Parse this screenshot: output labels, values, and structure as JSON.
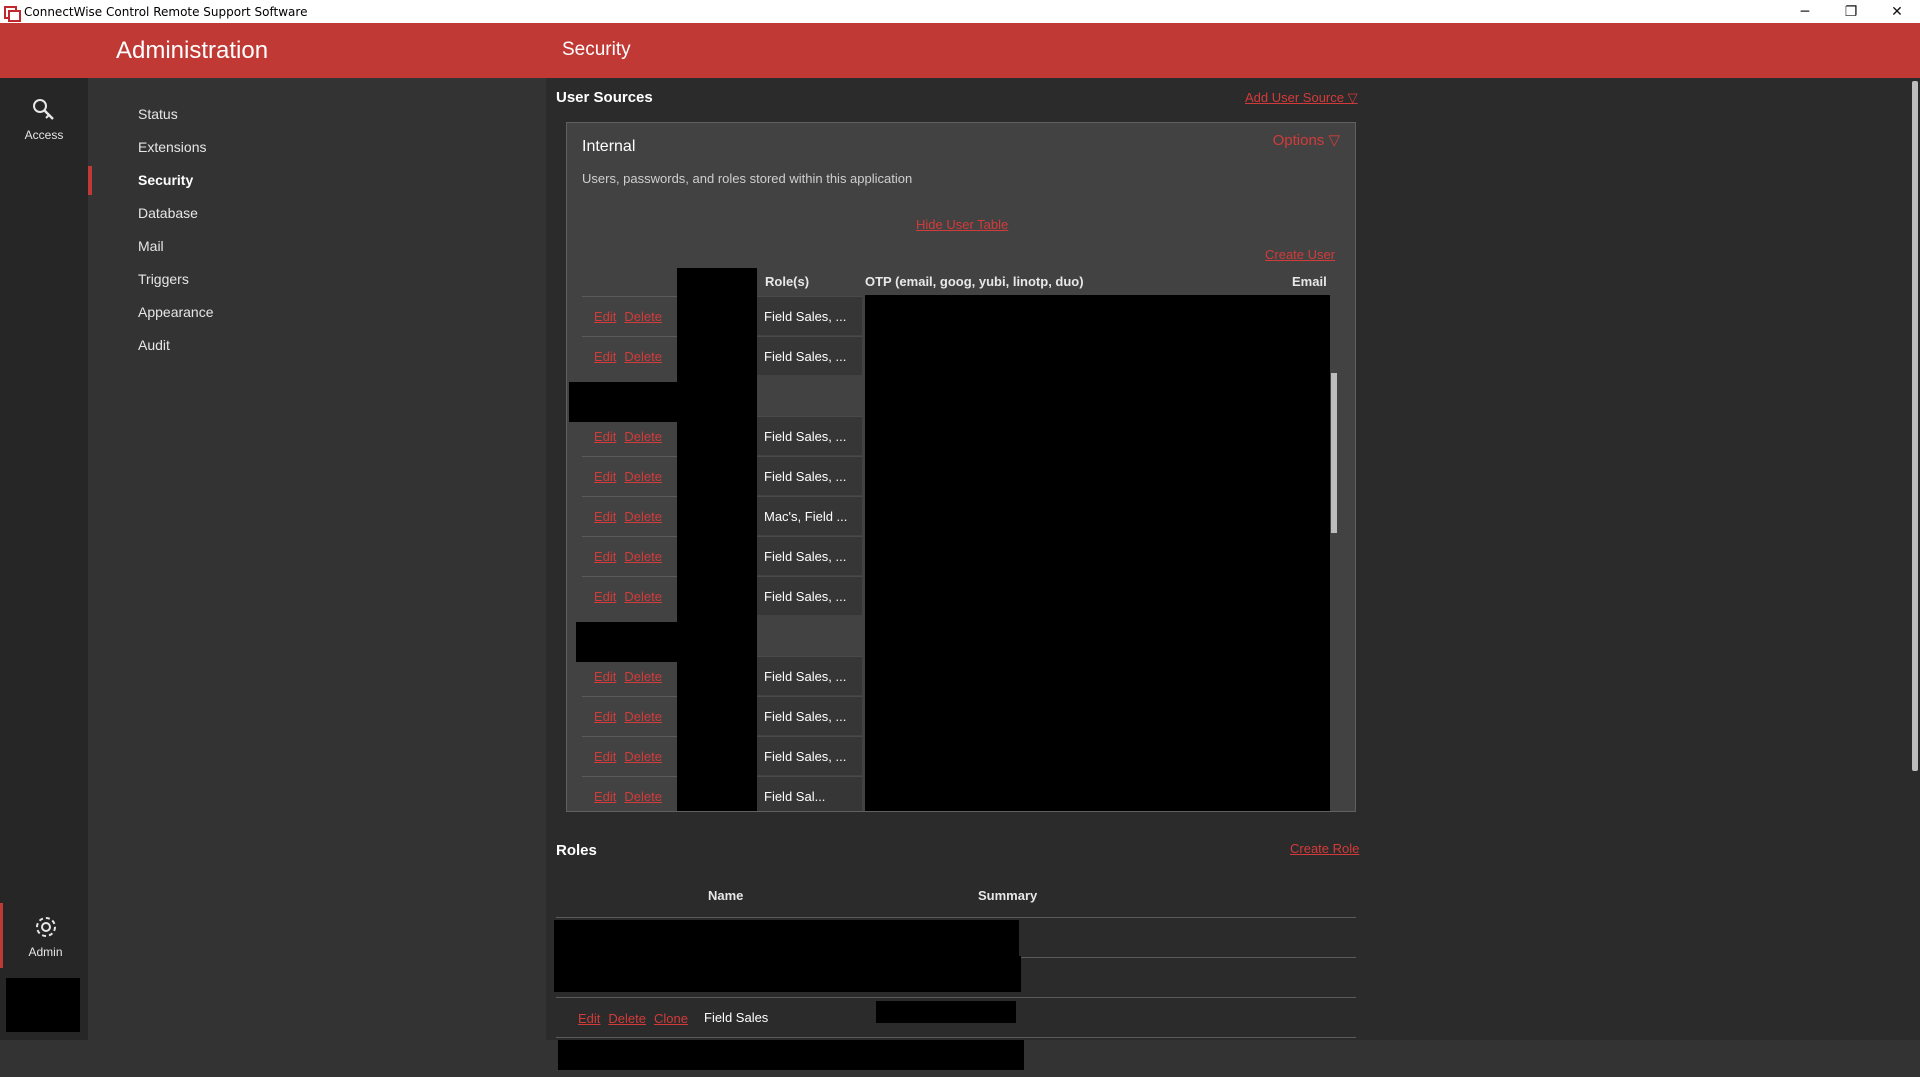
{
  "window": {
    "title": "ConnectWise Control Remote Support Software",
    "controls": {
      "minimize": "─",
      "restore": "❐",
      "close": "✕"
    }
  },
  "rail": {
    "items": [
      {
        "label": "Access",
        "icon": "key-search-icon"
      },
      {
        "label": "Admin",
        "icon": "gear-icon"
      }
    ]
  },
  "adminnav": {
    "title": "Administration",
    "items": [
      {
        "label": "Status"
      },
      {
        "label": "Extensions"
      },
      {
        "label": "Security"
      },
      {
        "label": "Database"
      },
      {
        "label": "Mail"
      },
      {
        "label": "Triggers"
      },
      {
        "label": "Appearance"
      },
      {
        "label": "Audit"
      }
    ],
    "active": "Security"
  },
  "page": {
    "title": "Security",
    "user_sources": {
      "title": "User Sources",
      "add_link": "Add User Source ▽",
      "internal": {
        "title": "Internal",
        "options_link": "Options ▽",
        "description": "Users, passwords, and roles stored within this application",
        "hide_table_link": "Hide User Table",
        "create_user_link": "Create User",
        "columns": [
          "Role(s)",
          "OTP (email, goog, yubi, linotp, duo)",
          "Email"
        ],
        "edit_label": "Edit",
        "delete_label": "Delete",
        "rows": [
          {
            "roles": "Field Sales, ..."
          },
          {
            "roles": "Field Sales, ..."
          },
          {
            "roles": ""
          },
          {
            "roles": "Field Sales, ..."
          },
          {
            "roles": "Field Sales, ..."
          },
          {
            "roles": "Mac's, Field ..."
          },
          {
            "roles": "Field Sales, ..."
          },
          {
            "roles": "Field Sales, ..."
          },
          {
            "roles": ""
          },
          {
            "roles": "Field Sales, ..."
          },
          {
            "roles": "Field Sales, ..."
          },
          {
            "roles": "Field Sales, ..."
          },
          {
            "roles": "Field Sal..."
          }
        ]
      }
    },
    "roles": {
      "title": "Roles",
      "create_link": "Create Role",
      "columns": [
        "Name",
        "Summary"
      ],
      "edit_label": "Edit",
      "delete_label": "Delete",
      "clone_label": "Clone",
      "visible_role_name": "Field Sales"
    }
  }
}
